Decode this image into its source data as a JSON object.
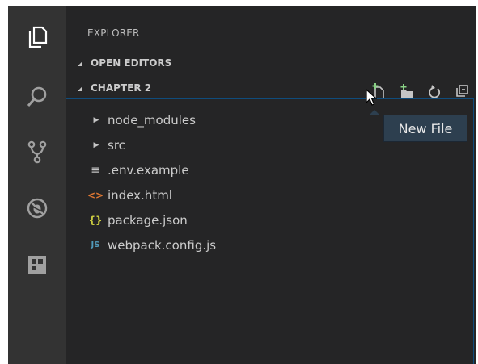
{
  "explorer": {
    "title": "EXPLORER",
    "sections": [
      {
        "label": "OPEN EDITORS"
      },
      {
        "label": "CHAPTER 2"
      }
    ]
  },
  "tree": {
    "items": [
      {
        "label": "node_modules",
        "icon": "folder-chevron-icon"
      },
      {
        "label": "src",
        "icon": "folder-chevron-icon"
      },
      {
        "label": ".env.example",
        "icon": "lines-file-icon"
      },
      {
        "label": "index.html",
        "icon": "html-file-icon"
      },
      {
        "label": "package.json",
        "icon": "json-file-icon"
      },
      {
        "label": "webpack.config.js",
        "icon": "js-file-icon"
      }
    ]
  },
  "tooltip": {
    "text": "New File"
  },
  "colors": {
    "accent": "#0e639c",
    "html_icon": "#e37933",
    "json_icon": "#cbcb41",
    "js_icon": "#519aba",
    "add_icon": "#89d185"
  }
}
